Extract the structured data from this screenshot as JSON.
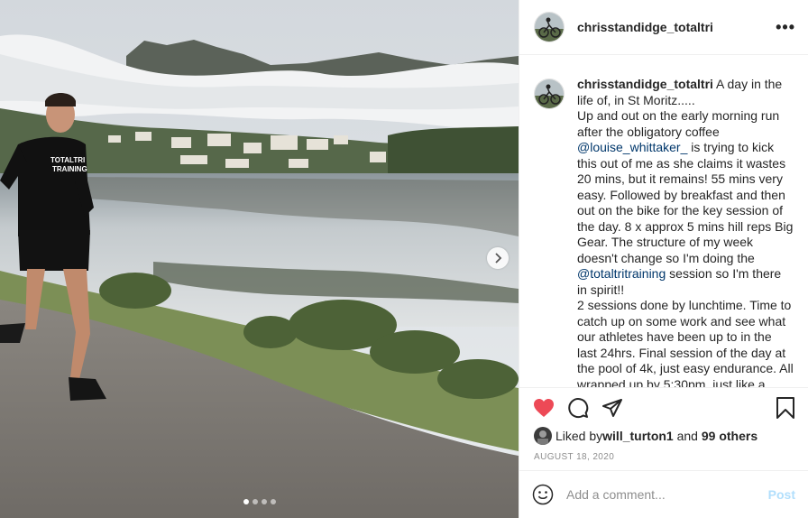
{
  "post": {
    "username": "chrisstandidge_totaltri",
    "caption_parts": {
      "intro": " A day in the life of, in St Moritz.....",
      "p1": "Up and out on the early morning run after the obligatory coffee ",
      "mention1": "@louise_whittaker_",
      "p2": " is trying to kick this out of me as she claims it wastes 20 mins, but it remains! 55 mins very easy. Followed by breakfast and then out on the bike for the key session of the day. 8 x approx 5 mins hill reps Big Gear. The structure of my week doesn't change so I'm doing the ",
      "mention2": "@totaltritraining",
      "p3": " session so I'm there in spirit!!",
      "p4": "2 sessions done by lunchtime. Time to catch up on some work and see what our athletes have been up to in the last 24hrs. Final session of the day at the pool of 4k, just easy endurance. All wrapped up by 5:30pm, just like a"
    },
    "liked_by_label": "Liked by ",
    "liked_by_user": "will_turton1",
    "liked_and": " and ",
    "liked_others": "99 others",
    "date": "AUGUST 18, 2020",
    "comment_placeholder": "Add a comment...",
    "post_label": "Post",
    "more_label": "•••",
    "shirt_text_line1": "TOTALTRI",
    "shirt_text_line2": "TRAINING"
  },
  "carousel": {
    "count": 4,
    "active_index": 0
  },
  "icons": {
    "like": "heart-icon",
    "comment": "comment-icon",
    "share": "paper-plane-icon",
    "save": "bookmark-icon",
    "emoji": "smiley-icon",
    "next": "chevron-right-icon"
  },
  "colors": {
    "heart": "#ed4956",
    "mention": "#00376b",
    "post_button": "#b2dffc",
    "date": "#8e8e8e"
  }
}
